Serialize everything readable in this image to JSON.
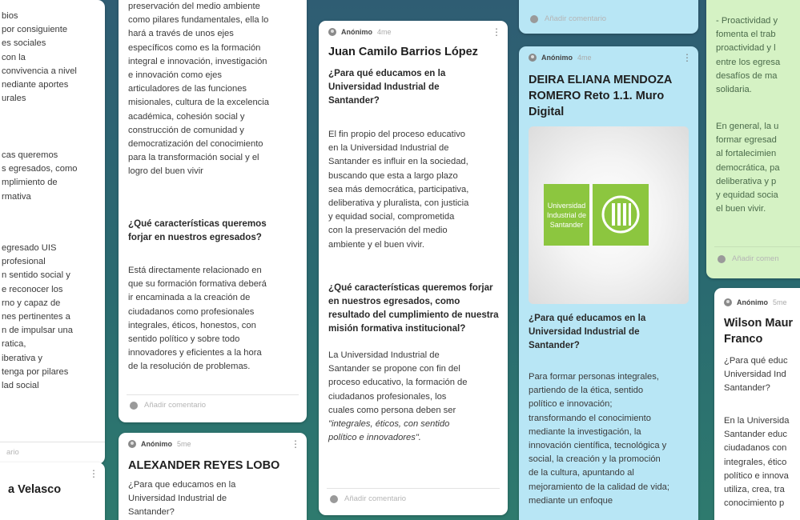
{
  "col1": {
    "lines": [
      "bios",
      "por consiguiente",
      "es sociales",
      "con la",
      "convivencia a nivel",
      "nediante aportes",
      "urales"
    ],
    "lines2": [
      "cas queremos",
      "s egresados, como",
      "mplimiento de",
      "rmativa"
    ],
    "lines3": [
      "egresado UIS",
      "profesional",
      "n sentido social y",
      "e reconocer los",
      "rno y capaz de",
      "nes pertinentes a",
      "n de impulsar una",
      "ratica,",
      "iberativa y",
      "tenga por pilares",
      "lad social"
    ],
    "footer": "ario",
    "next_title": "a Velasco"
  },
  "col2": {
    "top_lines": [
      "preservación del medio ambiente",
      "como pilares fundamentales, ella lo",
      "hará a través de unos ejes",
      "específicos como es la formación",
      "integral e innovación, investigación",
      "e innovación como ejes",
      "articuladores de las funciones",
      "misionales, cultura de la excelencia",
      "académica, cohesión social y",
      "construcción de comunidad y",
      "democratización del conocimiento",
      "para la transformación social y el",
      "logro del buen vivir"
    ],
    "question": "¿Qué características queremos forjar en nuestros egresados?",
    "answer_lines": [
      "Está directamente relacionado en",
      "que su formación formativa deberá",
      "ir encaminada a la creación de",
      "ciudadanos como profesionales",
      "integrales, éticos, honestos, con",
      "sentido político y sobre todo",
      "innovadores y eficientes a la hora",
      "de la resolución de problemas."
    ],
    "comment": "Añadir comentario",
    "card2_author": "Anónimo",
    "card2_time": "5me",
    "card2_title": "ALEXANDER REYES LOBO",
    "card2_q": [
      "¿Para que educamos en la",
      "Universidad Industrial de",
      "Santander?"
    ]
  },
  "col3": {
    "author": "Anónimo",
    "time": "4me",
    "title": "Juan Camilo Barrios López",
    "q1": "¿Para qué educamos en la Universidad Industrial de Santander?",
    "a1_lines": [
      "El fin propio del proceso educativo",
      "en la Universidad Industrial de",
      "Santander es influir en la sociedad,",
      "buscando que esta a largo plazo",
      "sea más democrática, participativa,",
      "deliberativa y pluralista, con justicia",
      "y equidad social, comprometida",
      "con la preservación del medio",
      "ambiente y el buen vivir."
    ],
    "q2": "¿Qué características queremos forjar en nuestros egresados, como resultado del cumplimiento de nuestra misión formativa institucional?",
    "a2_lines": [
      "La Universidad Industrial de",
      "Santander se propone con fin del",
      "proceso educativo, la formación de",
      "ciudadanos profesionales, los",
      "cuales como persona deben ser"
    ],
    "a2_italic": [
      "\"integrales, éticos, con sentido",
      "político e innovadores\"."
    ],
    "comment": "Añadir comentario"
  },
  "col4": {
    "top_comment": "Añadir comentario",
    "author": "Anónimo",
    "time": "4me",
    "title": "DEIRA ELIANA MENDOZA ROMERO Reto 1.1. Muro Digital",
    "logo_text": [
      "Universidad",
      "Industrial de",
      "Santander"
    ],
    "q1": "¿Para qué educamos en la Universidad Industrial de Santander?",
    "a1_lines": [
      "Para formar personas integrales,",
      "partiendo de la ética, sentido",
      "político e innovación;",
      "transformando el conocimiento",
      "mediante la  investigación, la",
      "innovación científica, tecnológica y",
      "social, la creación y la promoción",
      "de la cultura, apuntando al",
      "mejoramiento de la calidad de vida;",
      "mediante un enfoque"
    ]
  },
  "col5": {
    "top_lines": [
      "- Proactividad y",
      "fomenta el trab",
      "proactividad y l",
      "entre los egresa",
      "desafíos de ma",
      "solidaria."
    ],
    "mid_lines": [
      "En general, la u",
      "formar egresad",
      "al fortalecimien",
      "democrática, pa",
      "deliberativa y p",
      "y equidad socia",
      "el buen vivir."
    ],
    "comment": "Añadir comen",
    "author": "Anónimo",
    "time": "5me",
    "title": [
      "Wilson Maur",
      "Franco"
    ],
    "q_lines": [
      "¿Para qué educ",
      "Universidad Ind",
      "Santander?"
    ],
    "a_lines": [
      "En la Universida",
      "Santander educ",
      "ciudadanos con",
      "integrales, ético",
      "político e innova",
      "utiliza, crea, tra",
      "conocimiento p"
    ]
  }
}
